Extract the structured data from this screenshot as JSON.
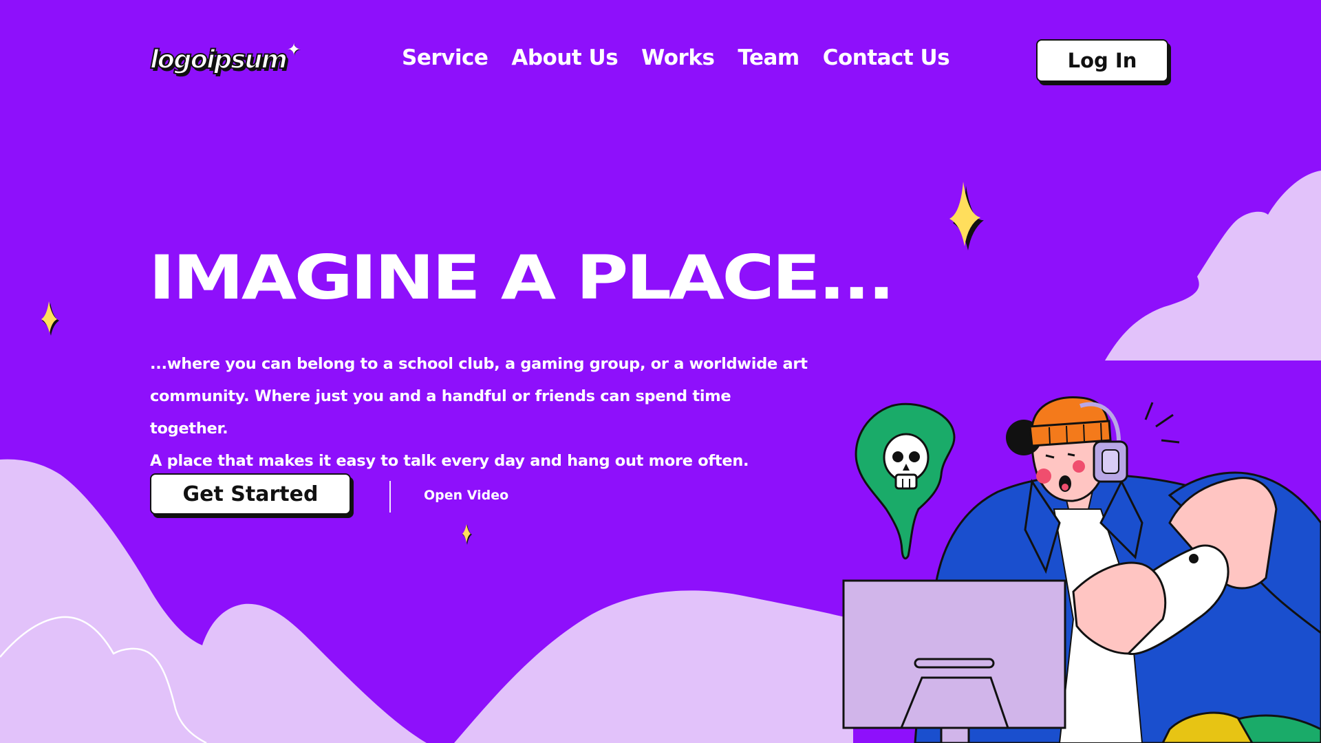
{
  "header": {
    "logo_text": "logoipsum",
    "nav": [
      {
        "label": "Service"
      },
      {
        "label": "About Us"
      },
      {
        "label": "Works"
      },
      {
        "label": "Team"
      },
      {
        "label": "Contact Us"
      }
    ],
    "login_label": "Log In"
  },
  "hero": {
    "title": "IMAGINE A PLACE...",
    "lines": [
      "...where you can belong to a school club, a gaming group, or a worldwide art",
      "community. Where just you and a handful or friends can spend time together.",
      "A place that makes it easy to talk every day and hang out more often."
    ],
    "cta_label": "Get Started",
    "video_label": "Open Video"
  },
  "colors": {
    "background": "#8e10fb",
    "hills": "#e2c2fa",
    "sparkle": "#ffde5c",
    "jacket": "#1a4fce",
    "beanie": "#f47a1b",
    "skin": "#ffc5c2",
    "ghost": "#1aab69",
    "monitor": "#d1b5ea"
  },
  "icons": [
    "sparkle-icon",
    "skull-icon",
    "headphones-icon",
    "gamepad-icon"
  ]
}
